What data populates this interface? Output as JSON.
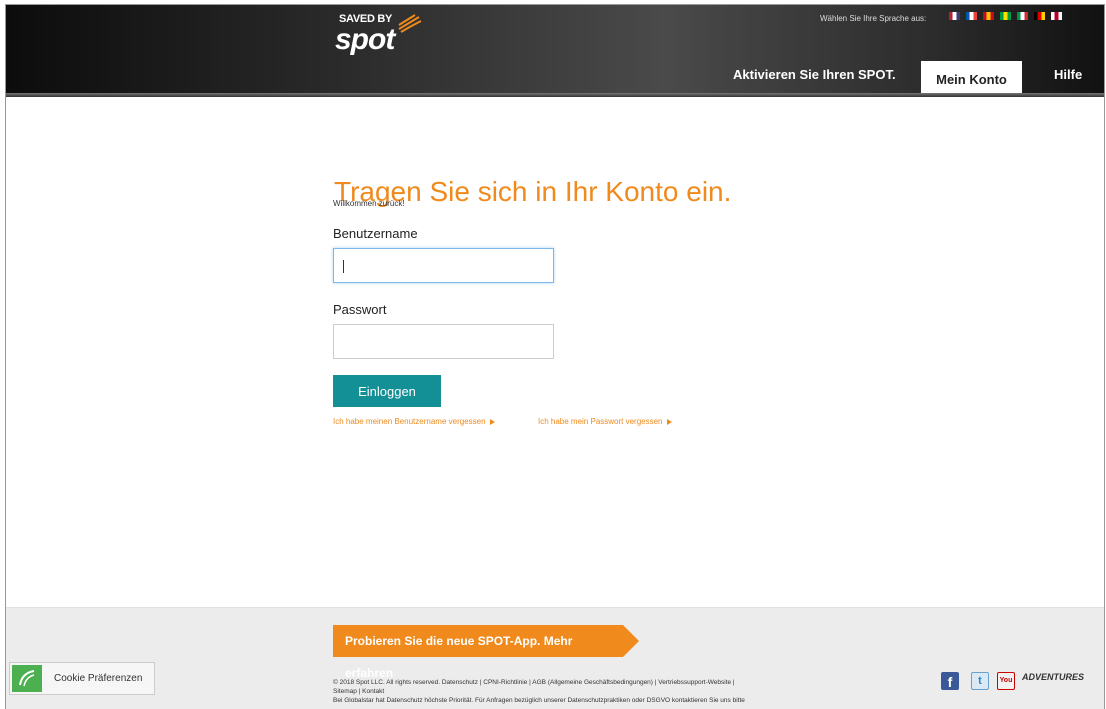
{
  "header": {
    "logo_top": "SAVED BY",
    "logo_main": "spot",
    "language_label": "Wählen Sie Ihre Sprache aus:",
    "flags": [
      {
        "name": "us-flag-icon",
        "colors": [
          "#b22234",
          "#fff",
          "#3c3b6e"
        ]
      },
      {
        "name": "fr-flag-icon",
        "colors": [
          "#0055a4",
          "#fff",
          "#ef4135"
        ]
      },
      {
        "name": "es-flag-icon",
        "colors": [
          "#c60b1e",
          "#ffc400",
          "#c60b1e"
        ]
      },
      {
        "name": "br-flag-icon",
        "colors": [
          "#009c3b",
          "#ffdf00",
          "#009c3b"
        ]
      },
      {
        "name": "it-flag-icon",
        "colors": [
          "#009246",
          "#fff",
          "#ce2b37"
        ]
      },
      {
        "name": "de-flag-icon",
        "colors": [
          "#000",
          "#dd0000",
          "#ffce00"
        ]
      },
      {
        "name": "jp-flag-icon",
        "colors": [
          "#fff",
          "#bc002d",
          "#fff"
        ]
      }
    ],
    "nav": {
      "activate": "Aktivieren Sie Ihren SPOT.",
      "account": "Mein Konto",
      "help": "Hilfe"
    }
  },
  "login": {
    "title": "Tragen Sie sich in Ihr Konto ein.",
    "welcome": "Willkommen zurück!",
    "username_label": "Benutzername",
    "username_value": "",
    "password_label": "Passwort",
    "password_value": "",
    "submit_label": "Einloggen",
    "forgot_username": "Ich habe meinen Benutzername vergessen",
    "forgot_password": "Ich habe mein Passwort vergessen"
  },
  "footer": {
    "app_banner": "Probieren Sie die neue SPOT-App. Mehr erfahren",
    "legal_line1": "© 2018 Spot LLC. All rights reserved. Datenschutz | CPNI-Richtlinie | AGB (Allgemeine Geschäftsbedingungen) | Vertriebssupport-Website |",
    "legal_line2": "Sitemap | Kontakt",
    "legal_line3": "Bei Globalstar hat Datenschutz höchste Priorität. Für Anfragen bezüglich unserer Datenschutzpraktiken oder DSGVO kontaktieren Sie uns bitte",
    "cookie_label": "Cookie Präferenzen",
    "social": {
      "facebook": "f",
      "twitter": "t",
      "youtube": "You",
      "adventures": "ADVENTURES"
    }
  },
  "colors": {
    "accent_orange": "#f08a1c",
    "button_teal": "#138f96",
    "cookie_green": "#4caf50"
  }
}
